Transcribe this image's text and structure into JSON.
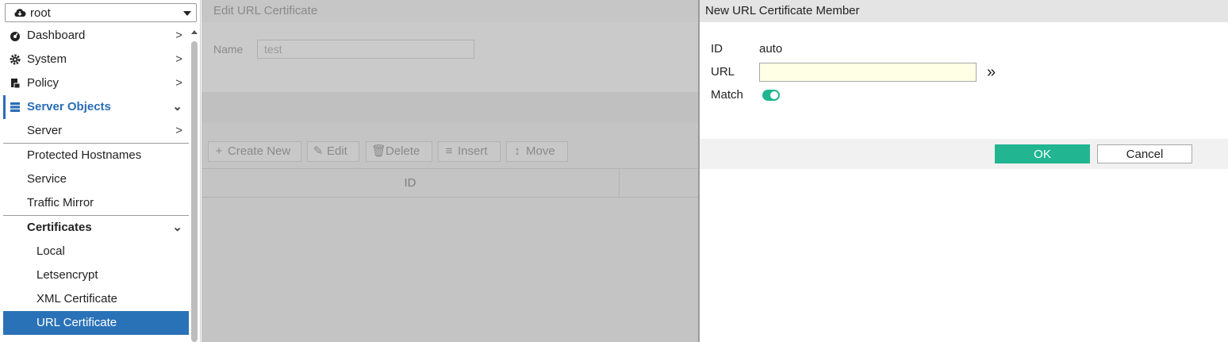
{
  "vdom": {
    "value": "root",
    "icon": "cloud-icon"
  },
  "nav": {
    "dashboard": "Dashboard",
    "system": "System",
    "policy": "Policy",
    "server_objects": "Server Objects",
    "server": "Server",
    "protected_hostnames": "Protected Hostnames",
    "service": "Service",
    "traffic_mirror": "Traffic Mirror",
    "certificates": "Certificates",
    "local": "Local",
    "letsencrypt": "Letsencrypt",
    "xml_certificate": "XML Certificate",
    "url_certificate": "URL Certificate"
  },
  "background": {
    "title": "Edit URL Certificate",
    "name_label": "Name",
    "name_value": "test",
    "toolbar": {
      "create_new": "Create New",
      "edit": "Edit",
      "delete": "Delete",
      "insert": "Insert",
      "move": "Move"
    },
    "column_id": "ID"
  },
  "dialog": {
    "title": "New URL Certificate Member",
    "id_label": "ID",
    "id_value": "auto",
    "url_label": "URL",
    "url_value": "",
    "match_label": "Match",
    "match_enabled": true,
    "ok_label": "OK",
    "cancel_label": "Cancel"
  },
  "colors": {
    "accent": "#2a72b8",
    "ok_button": "#22b592",
    "toggle_on": "#1fb58f",
    "url_field_bg": "#ffffe6"
  }
}
